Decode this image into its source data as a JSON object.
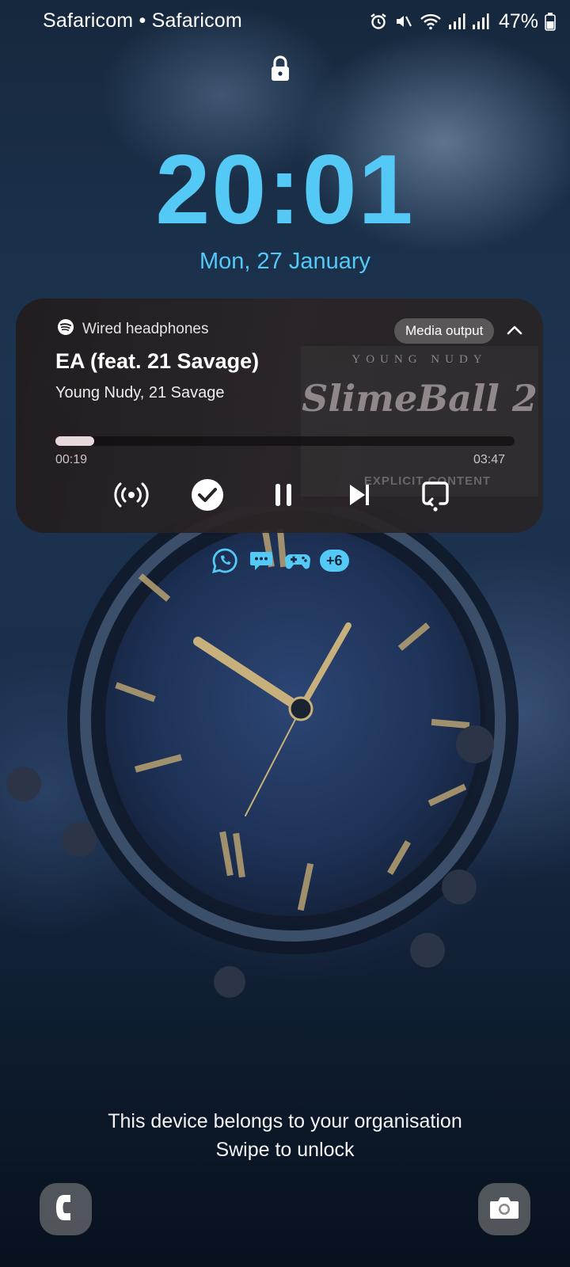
{
  "status_bar": {
    "carrier": "Safaricom • Safaricom",
    "battery": "47%",
    "icons": [
      "alarm-icon",
      "mute-icon",
      "wifi-icon",
      "signal-icon",
      "signal-icon",
      "battery-icon"
    ]
  },
  "lockscreen": {
    "time": "20:01",
    "date": "Mon, 27 January",
    "accent_color": "#54c9f6"
  },
  "media": {
    "app": "spotify",
    "output_label": "Wired headphones",
    "media_output_button": "Media output",
    "title": "EA (feat. 21 Savage)",
    "artist": "Young Nudy, 21 Savage",
    "elapsed": "00:19",
    "duration": "03:47",
    "progress_fraction": 0.084,
    "controls": [
      "broadcast-icon",
      "check-icon",
      "pause-icon",
      "next-track-icon",
      "cast-icon"
    ],
    "artwork_text": {
      "top": "YOUNG NUDY",
      "logo": "SlimeBall 2",
      "badge": "EXPLICIT CONTENT"
    }
  },
  "notifications": {
    "icons": [
      "whatsapp-icon",
      "messages-icon",
      "game-controller-icon"
    ],
    "more": "+6"
  },
  "footer": {
    "org_notice": "This device belongs to your organisation",
    "unlock_hint": "Swipe to unlock"
  },
  "shortcuts": {
    "left": "phone-icon",
    "right": "camera-icon"
  }
}
